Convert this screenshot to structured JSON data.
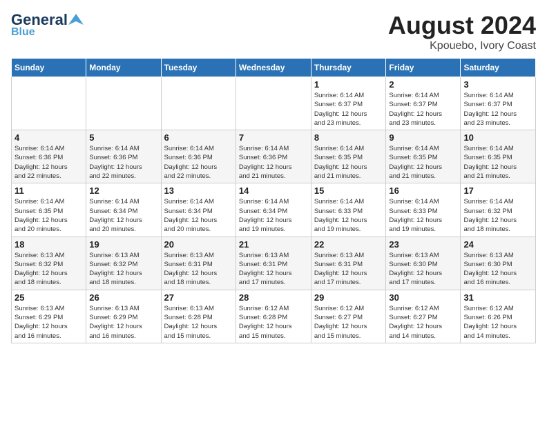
{
  "header": {
    "logo_general": "General",
    "logo_blue": "Blue",
    "month": "August 2024",
    "location": "Kpouebo, Ivory Coast"
  },
  "days_of_week": [
    "Sunday",
    "Monday",
    "Tuesday",
    "Wednesday",
    "Thursday",
    "Friday",
    "Saturday"
  ],
  "weeks": [
    [
      {
        "day": "",
        "info": ""
      },
      {
        "day": "",
        "info": ""
      },
      {
        "day": "",
        "info": ""
      },
      {
        "day": "",
        "info": ""
      },
      {
        "day": "1",
        "info": "Sunrise: 6:14 AM\nSunset: 6:37 PM\nDaylight: 12 hours\nand 23 minutes."
      },
      {
        "day": "2",
        "info": "Sunrise: 6:14 AM\nSunset: 6:37 PM\nDaylight: 12 hours\nand 23 minutes."
      },
      {
        "day": "3",
        "info": "Sunrise: 6:14 AM\nSunset: 6:37 PM\nDaylight: 12 hours\nand 23 minutes."
      }
    ],
    [
      {
        "day": "4",
        "info": "Sunrise: 6:14 AM\nSunset: 6:36 PM\nDaylight: 12 hours\nand 22 minutes."
      },
      {
        "day": "5",
        "info": "Sunrise: 6:14 AM\nSunset: 6:36 PM\nDaylight: 12 hours\nand 22 minutes."
      },
      {
        "day": "6",
        "info": "Sunrise: 6:14 AM\nSunset: 6:36 PM\nDaylight: 12 hours\nand 22 minutes."
      },
      {
        "day": "7",
        "info": "Sunrise: 6:14 AM\nSunset: 6:36 PM\nDaylight: 12 hours\nand 21 minutes."
      },
      {
        "day": "8",
        "info": "Sunrise: 6:14 AM\nSunset: 6:35 PM\nDaylight: 12 hours\nand 21 minutes."
      },
      {
        "day": "9",
        "info": "Sunrise: 6:14 AM\nSunset: 6:35 PM\nDaylight: 12 hours\nand 21 minutes."
      },
      {
        "day": "10",
        "info": "Sunrise: 6:14 AM\nSunset: 6:35 PM\nDaylight: 12 hours\nand 21 minutes."
      }
    ],
    [
      {
        "day": "11",
        "info": "Sunrise: 6:14 AM\nSunset: 6:35 PM\nDaylight: 12 hours\nand 20 minutes."
      },
      {
        "day": "12",
        "info": "Sunrise: 6:14 AM\nSunset: 6:34 PM\nDaylight: 12 hours\nand 20 minutes."
      },
      {
        "day": "13",
        "info": "Sunrise: 6:14 AM\nSunset: 6:34 PM\nDaylight: 12 hours\nand 20 minutes."
      },
      {
        "day": "14",
        "info": "Sunrise: 6:14 AM\nSunset: 6:34 PM\nDaylight: 12 hours\nand 19 minutes."
      },
      {
        "day": "15",
        "info": "Sunrise: 6:14 AM\nSunset: 6:33 PM\nDaylight: 12 hours\nand 19 minutes."
      },
      {
        "day": "16",
        "info": "Sunrise: 6:14 AM\nSunset: 6:33 PM\nDaylight: 12 hours\nand 19 minutes."
      },
      {
        "day": "17",
        "info": "Sunrise: 6:14 AM\nSunset: 6:32 PM\nDaylight: 12 hours\nand 18 minutes."
      }
    ],
    [
      {
        "day": "18",
        "info": "Sunrise: 6:13 AM\nSunset: 6:32 PM\nDaylight: 12 hours\nand 18 minutes."
      },
      {
        "day": "19",
        "info": "Sunrise: 6:13 AM\nSunset: 6:32 PM\nDaylight: 12 hours\nand 18 minutes."
      },
      {
        "day": "20",
        "info": "Sunrise: 6:13 AM\nSunset: 6:31 PM\nDaylight: 12 hours\nand 18 minutes."
      },
      {
        "day": "21",
        "info": "Sunrise: 6:13 AM\nSunset: 6:31 PM\nDaylight: 12 hours\nand 17 minutes."
      },
      {
        "day": "22",
        "info": "Sunrise: 6:13 AM\nSunset: 6:31 PM\nDaylight: 12 hours\nand 17 minutes."
      },
      {
        "day": "23",
        "info": "Sunrise: 6:13 AM\nSunset: 6:30 PM\nDaylight: 12 hours\nand 17 minutes."
      },
      {
        "day": "24",
        "info": "Sunrise: 6:13 AM\nSunset: 6:30 PM\nDaylight: 12 hours\nand 16 minutes."
      }
    ],
    [
      {
        "day": "25",
        "info": "Sunrise: 6:13 AM\nSunset: 6:29 PM\nDaylight: 12 hours\nand 16 minutes."
      },
      {
        "day": "26",
        "info": "Sunrise: 6:13 AM\nSunset: 6:29 PM\nDaylight: 12 hours\nand 16 minutes."
      },
      {
        "day": "27",
        "info": "Sunrise: 6:13 AM\nSunset: 6:28 PM\nDaylight: 12 hours\nand 15 minutes."
      },
      {
        "day": "28",
        "info": "Sunrise: 6:12 AM\nSunset: 6:28 PM\nDaylight: 12 hours\nand 15 minutes."
      },
      {
        "day": "29",
        "info": "Sunrise: 6:12 AM\nSunset: 6:27 PM\nDaylight: 12 hours\nand 15 minutes."
      },
      {
        "day": "30",
        "info": "Sunrise: 6:12 AM\nSunset: 6:27 PM\nDaylight: 12 hours\nand 14 minutes."
      },
      {
        "day": "31",
        "info": "Sunrise: 6:12 AM\nSunset: 6:26 PM\nDaylight: 12 hours\nand 14 minutes."
      }
    ]
  ]
}
